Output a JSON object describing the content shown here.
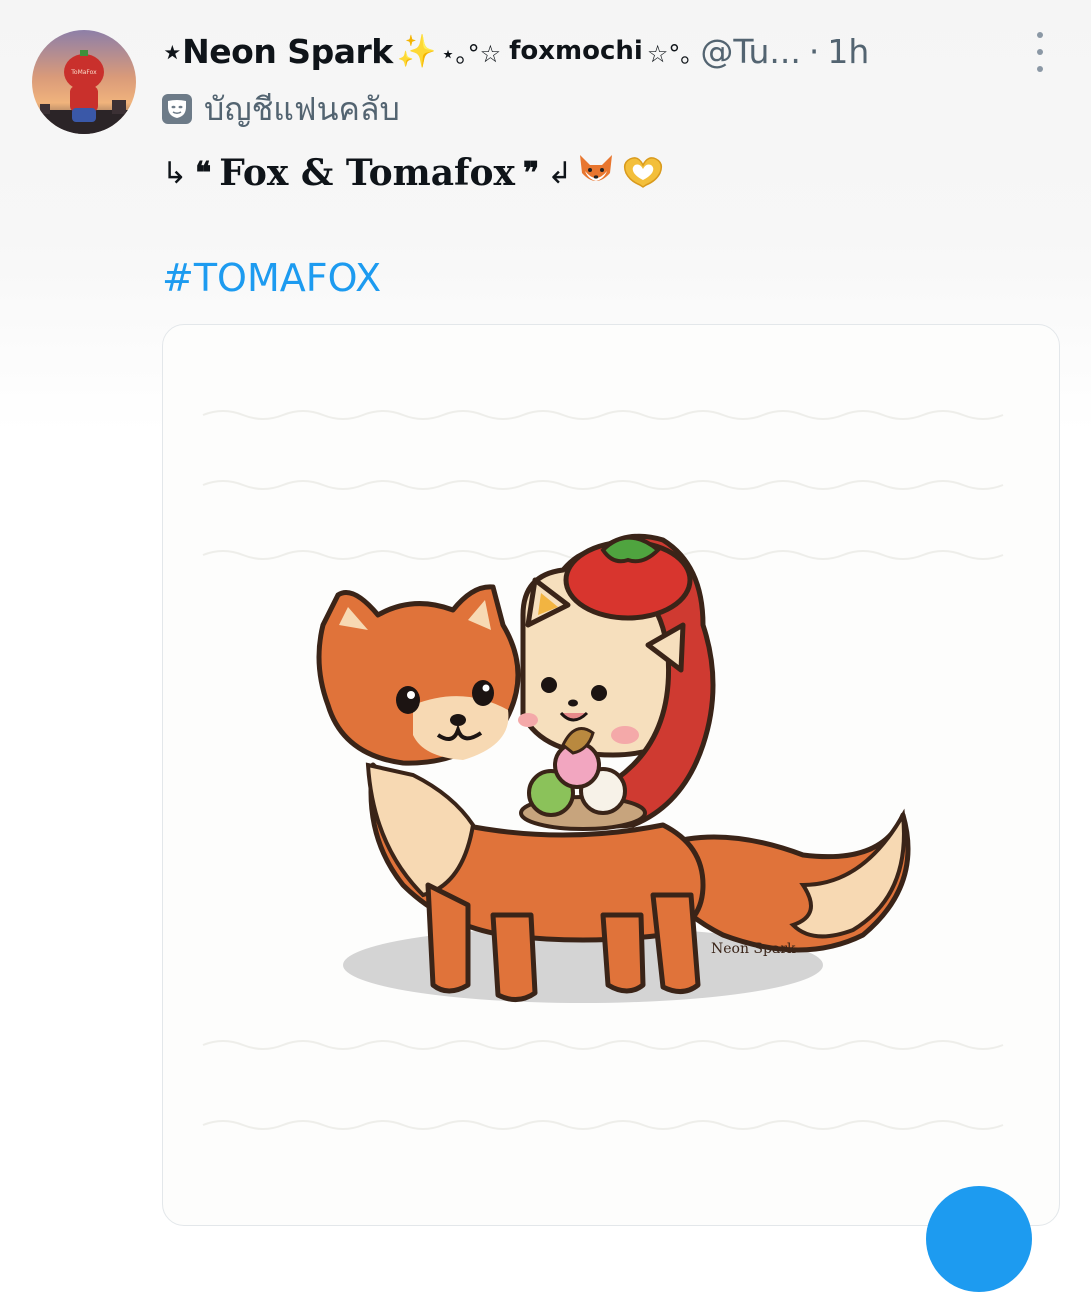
{
  "tweet": {
    "display_name": "⋆Neon Spark",
    "name_sparkle": "✨",
    "name_suffix_pre": "⋆｡°☆",
    "name_suffix_word": "foxmochi",
    "name_suffix_post": "☆°｡",
    "handle": "@Tu...",
    "separator": "·",
    "time": "1h",
    "affiliation": "บัญชีแฟนคลับ",
    "text_arrow_left": "↳",
    "text_quote_open": "❝",
    "text_title": "Fox & Tomafox",
    "text_quote_close": "❞",
    "text_arrow_right": "↲",
    "hashtag": "#TOMAFOX"
  },
  "media": {
    "signature": "Neon Spark"
  },
  "icons": {
    "more": "more-vertical-icon",
    "affiliation": "fan-account-badge-icon",
    "fox_emoji": "fox-emoji-icon",
    "heart_hands": "heart-hands-emoji-icon"
  },
  "colors": {
    "accent": "#1d9bf0",
    "secondary_text": "#536471",
    "fox_orange": "#e0733a",
    "tomato_red": "#d8352e"
  }
}
